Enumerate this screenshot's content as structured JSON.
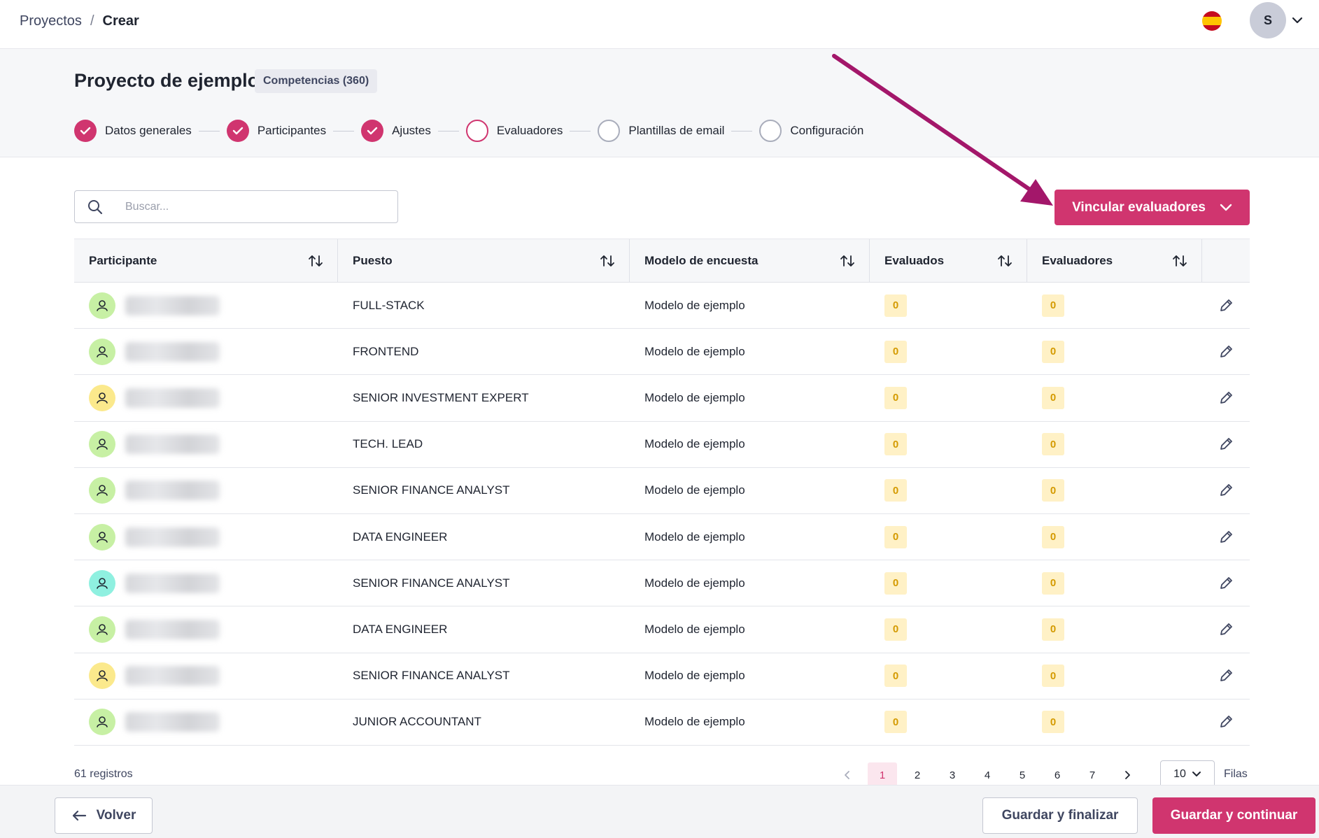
{
  "breadcrumb": {
    "parent": "Proyectos",
    "separator": "/",
    "current": "Crear"
  },
  "user": {
    "initial": "S",
    "language": "es"
  },
  "project": {
    "title": "Proyecto de ejemplo",
    "type_badge": "Competencias (360)"
  },
  "steps": [
    {
      "label": "Datos generales",
      "state": "done"
    },
    {
      "label": "Participantes",
      "state": "done"
    },
    {
      "label": "Ajustes",
      "state": "done"
    },
    {
      "label": "Evaluadores",
      "state": "current"
    },
    {
      "label": "Plantillas de email",
      "state": "pending"
    },
    {
      "label": "Configuración",
      "state": "pending"
    }
  ],
  "search": {
    "placeholder": "Buscar..."
  },
  "link_button": {
    "label": "Vincular evaluadores"
  },
  "table": {
    "headers": [
      "Participante",
      "Puesto",
      "Modelo de encuesta",
      "Evaluados",
      "Evaluadores"
    ],
    "rows": [
      {
        "avatar_color": "#c7f0a4",
        "puesto": "FULL-STACK",
        "modelo": "Modelo de ejemplo",
        "evaluados": "0",
        "evaluadores": "0"
      },
      {
        "avatar_color": "#c7f0a4",
        "puesto": "FRONTEND",
        "modelo": "Modelo de ejemplo",
        "evaluados": "0",
        "evaluadores": "0"
      },
      {
        "avatar_color": "#fbe98c",
        "puesto": "SENIOR INVESTMENT EXPERT",
        "modelo": "Modelo de ejemplo",
        "evaluados": "0",
        "evaluadores": "0"
      },
      {
        "avatar_color": "#c7f0a4",
        "puesto": "TECH. LEAD",
        "modelo": "Modelo de ejemplo",
        "evaluados": "0",
        "evaluadores": "0"
      },
      {
        "avatar_color": "#c7f0a4",
        "puesto": "SENIOR FINANCE ANALYST",
        "modelo": "Modelo de ejemplo",
        "evaluados": "0",
        "evaluadores": "0"
      },
      {
        "avatar_color": "#c7f0a4",
        "puesto": "DATA ENGINEER",
        "modelo": "Modelo de ejemplo",
        "evaluados": "0",
        "evaluadores": "0"
      },
      {
        "avatar_color": "#8ff0e0",
        "puesto": "SENIOR FINANCE ANALYST",
        "modelo": "Modelo de ejemplo",
        "evaluados": "0",
        "evaluadores": "0"
      },
      {
        "avatar_color": "#c7f0a4",
        "puesto": "DATA ENGINEER",
        "modelo": "Modelo de ejemplo",
        "evaluados": "0",
        "evaluadores": "0"
      },
      {
        "avatar_color": "#fbe98c",
        "puesto": "SENIOR FINANCE ANALYST",
        "modelo": "Modelo de ejemplo",
        "evaluados": "0",
        "evaluadores": "0"
      },
      {
        "avatar_color": "#c7f0a4",
        "puesto": "JUNIOR ACCOUNTANT",
        "modelo": "Modelo de ejemplo",
        "evaluados": "0",
        "evaluadores": "0"
      }
    ]
  },
  "footer": {
    "records": "61 registros",
    "pages": [
      "1",
      "2",
      "3",
      "4",
      "5",
      "6",
      "7"
    ],
    "current_page": "1",
    "rows_per_page": "10",
    "rows_label": "Filas"
  },
  "actions": {
    "back": "Volver",
    "save_finish": "Guardar y finalizar",
    "save_continue": "Guardar y continuar"
  },
  "colors": {
    "accent": "#d0356f",
    "annotation_arrow": "#a3176a",
    "count_bg": "#fff1c6",
    "count_text": "#d49a00"
  }
}
